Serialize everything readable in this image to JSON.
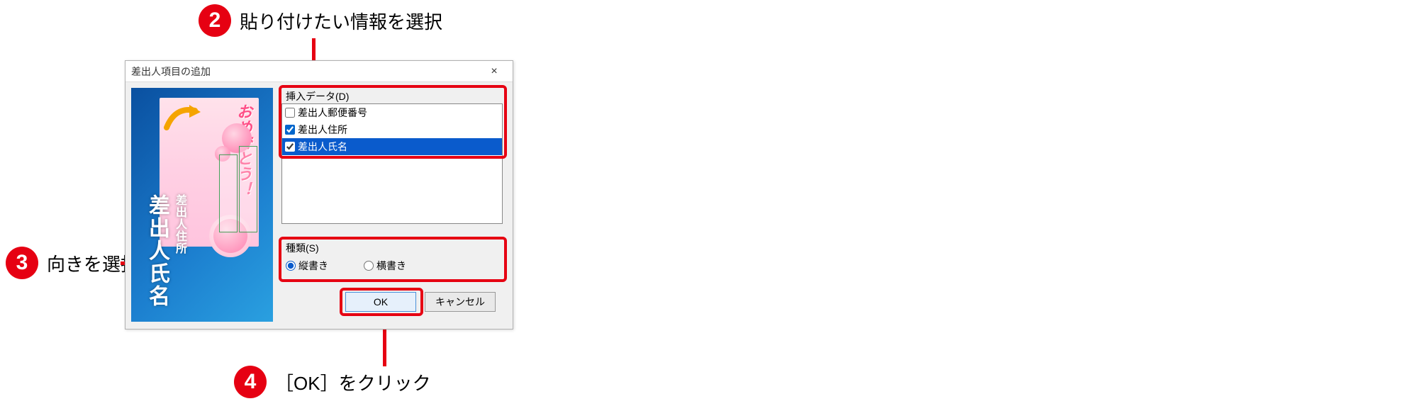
{
  "callouts": {
    "c2": {
      "num": "2",
      "text": "貼り付けたい情報を選択"
    },
    "c3": {
      "num": "3",
      "text": "向きを選択"
    },
    "c4": {
      "num": "4",
      "text": "［OK］をクリック"
    }
  },
  "dialog": {
    "title": "差出人項目の追加",
    "close": "×",
    "preview": {
      "greeting": "おめでとう！",
      "big_name": "差出人氏名",
      "small_addr": "差出人住所"
    },
    "insert": {
      "label": "挿入データ(D)",
      "items": [
        {
          "label": "差出人郵便番号",
          "checked": false,
          "selected": false
        },
        {
          "label": "差出人住所",
          "checked": true,
          "selected": false
        },
        {
          "label": "差出人氏名",
          "checked": true,
          "selected": true
        }
      ]
    },
    "kind": {
      "label": "種類(S)",
      "options": {
        "vertical": "縦書き",
        "horizontal": "横書き"
      },
      "value": "vertical"
    },
    "buttons": {
      "ok": "OK",
      "cancel": "キャンセル"
    }
  }
}
